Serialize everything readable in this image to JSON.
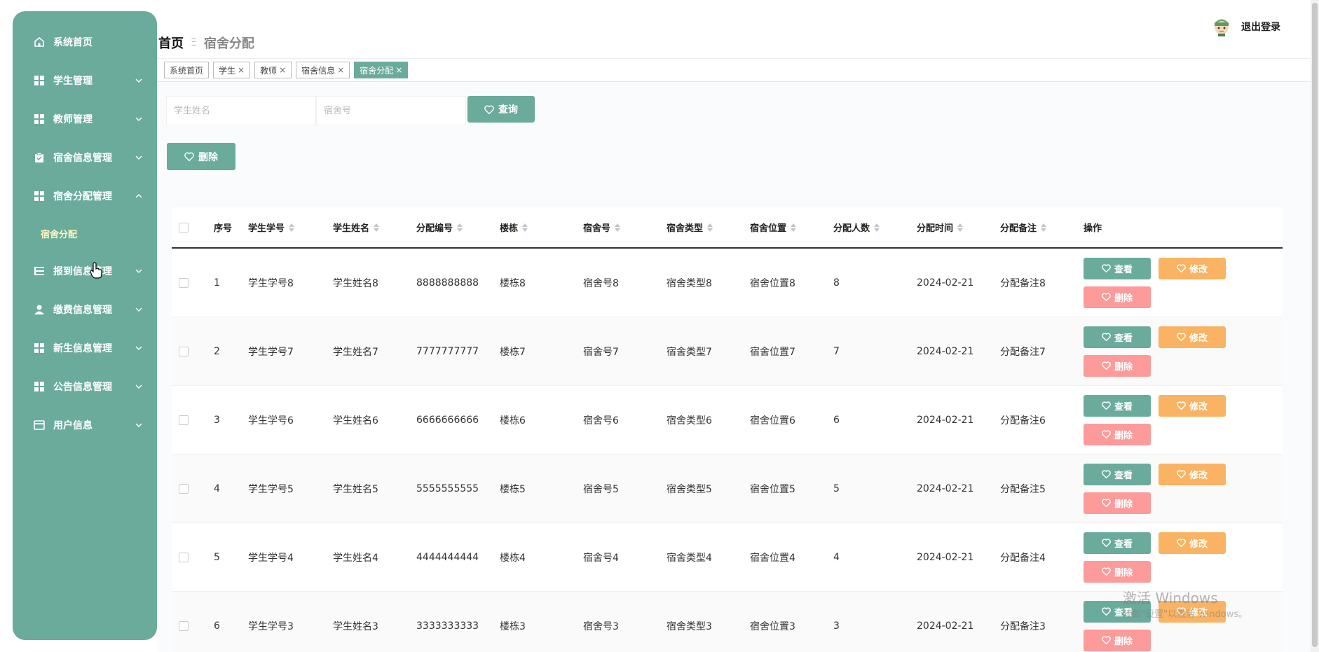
{
  "sidebar": {
    "items": [
      {
        "label": "系统首页",
        "icon": "home-icon",
        "expandable": false
      },
      {
        "label": "学生管理",
        "icon": "grid-icon",
        "expandable": true
      },
      {
        "label": "教师管理",
        "icon": "grid-icon",
        "expandable": true
      },
      {
        "label": "宿舍信息管理",
        "icon": "clipboard-icon",
        "expandable": true
      },
      {
        "label": "宿舍分配管理",
        "icon": "grid-icon",
        "expandable": true,
        "expanded": true
      },
      {
        "label": "报到信息管理",
        "icon": "list-icon",
        "expandable": true
      },
      {
        "label": "缴费信息管理",
        "icon": "user-icon",
        "expandable": true
      },
      {
        "label": "新生信息管理",
        "icon": "grid-icon",
        "expandable": true
      },
      {
        "label": "公告信息管理",
        "icon": "grid-icon",
        "expandable": true
      },
      {
        "label": "用户信息",
        "icon": "card-icon",
        "expandable": true
      }
    ],
    "submenu": {
      "label": "宿舍分配"
    }
  },
  "header": {
    "breadcrumb_home": "首页",
    "breadcrumb_sep": "Ξ",
    "breadcrumb_current": "宿舍分配",
    "logout": "退出登录"
  },
  "tags": [
    {
      "label": "系统首页",
      "closable": false,
      "active": false
    },
    {
      "label": "学生",
      "closable": true,
      "active": false
    },
    {
      "label": "教师",
      "closable": true,
      "active": false
    },
    {
      "label": "宿舍信息",
      "closable": true,
      "active": false
    },
    {
      "label": "宿舍分配",
      "closable": true,
      "active": true
    }
  ],
  "search": {
    "student_name_placeholder": "学生姓名",
    "room_placeholder": "宿舍号",
    "query_label": "查询"
  },
  "toolbar": {
    "delete_label": "删除"
  },
  "table": {
    "headers": {
      "idx": "序号",
      "sno": "学生学号",
      "sname": "学生姓名",
      "fno": "分配编号",
      "bld": "楼栋",
      "room": "宿舍号",
      "type": "宿舍类型",
      "loc": "宿舍位置",
      "cnt": "分配人数",
      "time": "分配时间",
      "note": "分配备注",
      "op": "操作"
    },
    "actions": {
      "view": "查看",
      "edit": "修改",
      "delete": "删除"
    },
    "rows": [
      {
        "idx": "1",
        "sno": "学生学号8",
        "sname": "学生姓名8",
        "fno": "8888888888",
        "bld": "楼栋8",
        "room": "宿舍号8",
        "type": "宿舍类型8",
        "loc": "宿舍位置8",
        "cnt": "8",
        "time": "2024-02-21",
        "note": "分配备注8"
      },
      {
        "idx": "2",
        "sno": "学生学号7",
        "sname": "学生姓名7",
        "fno": "7777777777",
        "bld": "楼栋7",
        "room": "宿舍号7",
        "type": "宿舍类型7",
        "loc": "宿舍位置7",
        "cnt": "7",
        "time": "2024-02-21",
        "note": "分配备注7"
      },
      {
        "idx": "3",
        "sno": "学生学号6",
        "sname": "学生姓名6",
        "fno": "6666666666",
        "bld": "楼栋6",
        "room": "宿舍号6",
        "type": "宿舍类型6",
        "loc": "宿舍位置6",
        "cnt": "6",
        "time": "2024-02-21",
        "note": "分配备注6"
      },
      {
        "idx": "4",
        "sno": "学生学号5",
        "sname": "学生姓名5",
        "fno": "5555555555",
        "bld": "楼栋5",
        "room": "宿舍号5",
        "type": "宿舍类型5",
        "loc": "宿舍位置5",
        "cnt": "5",
        "time": "2024-02-21",
        "note": "分配备注5"
      },
      {
        "idx": "5",
        "sno": "学生学号4",
        "sname": "学生姓名4",
        "fno": "4444444444",
        "bld": "楼栋4",
        "room": "宿舍号4",
        "type": "宿舍类型4",
        "loc": "宿舍位置4",
        "cnt": "4",
        "time": "2024-02-21",
        "note": "分配备注4"
      },
      {
        "idx": "6",
        "sno": "学生学号3",
        "sname": "学生姓名3",
        "fno": "3333333333",
        "bld": "楼栋3",
        "room": "宿舍号3",
        "type": "宿舍类型3",
        "loc": "宿舍位置3",
        "cnt": "3",
        "time": "2024-02-21",
        "note": "分配备注3"
      }
    ]
  },
  "watermark": {
    "line1": "激活 Windows",
    "line2": "转到\"设置\"以激活 Windows。"
  },
  "colors": {
    "primary": "#6aab9c",
    "edit": "#f9b363",
    "delete": "#fd9a9a",
    "submenu_text": "#fff7c0"
  }
}
